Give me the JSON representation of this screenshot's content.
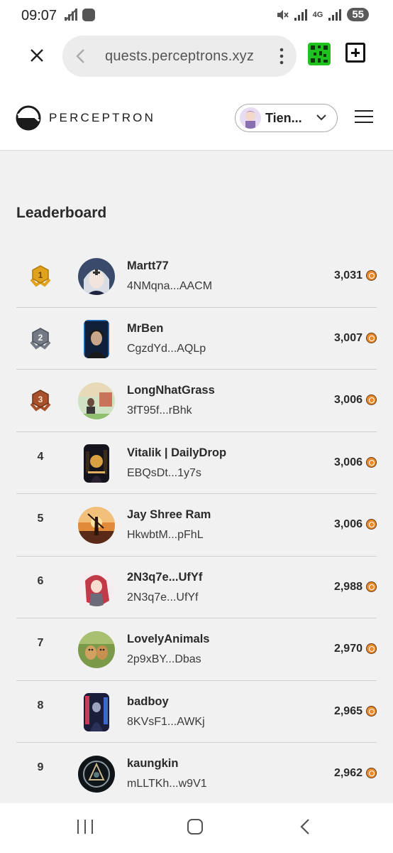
{
  "status_bar": {
    "time": "09:07",
    "network": "4G",
    "battery": "55"
  },
  "browser": {
    "url": "quests.perceptrons.xyz"
  },
  "site": {
    "brand": "PERCEPTRON",
    "user_name": "Tien..."
  },
  "leaderboard": {
    "title": "Leaderboard",
    "rows": [
      {
        "rank": "1",
        "name": "Martt77",
        "address": "4NMqna...AACM",
        "score": "3,031"
      },
      {
        "rank": "2",
        "name": "MrBen",
        "address": "CgzdYd...AQLp",
        "score": "3,007"
      },
      {
        "rank": "3",
        "name": "LongNhatGrass",
        "address": "3fT95f...rBhk",
        "score": "3,006"
      },
      {
        "rank": "4",
        "name": "Vitalik | DailyDrop",
        "address": "EBQsDt...1y7s",
        "score": "3,006"
      },
      {
        "rank": "5",
        "name": "Jay Shree Ram",
        "address": "HkwbtM...pFhL",
        "score": "3,006"
      },
      {
        "rank": "6",
        "name": "2N3q7e...UfYf",
        "address": "2N3q7e...UfYf",
        "score": "2,988"
      },
      {
        "rank": "7",
        "name": "LovelyAnimals",
        "address": "2p9xBY...Dbas",
        "score": "2,970"
      },
      {
        "rank": "8",
        "name": "badboy",
        "address": "8KVsF1...AWKj",
        "score": "2,965"
      },
      {
        "rank": "9",
        "name": "kaungkin",
        "address": "mLLTKh...w9V1",
        "score": "2,962"
      }
    ]
  },
  "colors": {
    "gold": "#e0a21c",
    "silver": "#737a86",
    "bronze": "#a8502a",
    "coin": "#e98a2c"
  }
}
